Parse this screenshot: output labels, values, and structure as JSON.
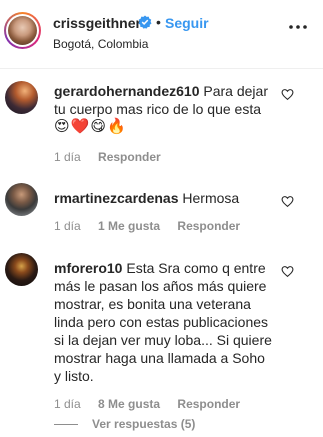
{
  "header": {
    "username": "crissgeithner",
    "separator": "•",
    "follow_label": "Seguir",
    "location": "Bogotá, Colombia",
    "verified_icon": "verified-badge-icon",
    "more_icon": "more-options-icon"
  },
  "comments": [
    {
      "username": "gerardohernandez610",
      "text": "Para dejar tu cuerpo mas rico de lo que esta",
      "emojis": "😍❤️😋🔥",
      "age": "1 día",
      "likes": "",
      "reply_label": "Responder"
    },
    {
      "username": "rmartinezcardenas",
      "text": "Hermosa",
      "emojis": "",
      "age": "1 día",
      "likes": "1 Me gusta",
      "reply_label": "Responder"
    },
    {
      "username": "mforero10",
      "text": "Esta Sra como q entre más le pasan los años más quiere mostrar, es bonita una veterana linda pero con estas publicaciones si la dejan ver muy loba... Si quiere mostrar haga una llamada a Soho y listo.",
      "emojis": "",
      "age": "1 día",
      "likes": "8 Me gusta",
      "reply_label": "Responder"
    }
  ],
  "view_replies_label": "Ver respuestas (5)",
  "colors": {
    "link_blue": "#3897f0",
    "text": "#262626",
    "muted": "#8e8e8e"
  }
}
